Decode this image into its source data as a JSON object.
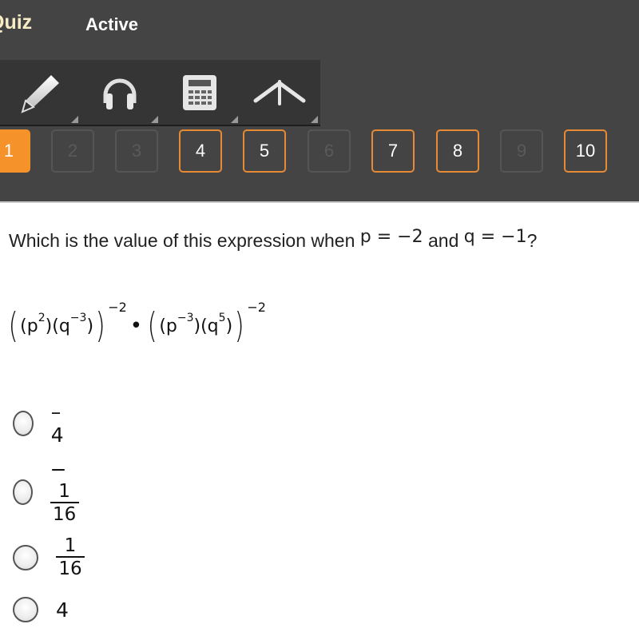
{
  "header": {
    "app_title": "Quiz",
    "status": "Active"
  },
  "toolbar": {
    "tools": [
      {
        "name": "pencil",
        "icon": "pencil-icon"
      },
      {
        "name": "audio",
        "icon": "headphones-icon"
      },
      {
        "name": "calculator",
        "icon": "calculator-icon"
      },
      {
        "name": "reference",
        "icon": "compass-icon"
      }
    ]
  },
  "question_nav": {
    "current": 1,
    "items": [
      {
        "label": "1",
        "state": "current"
      },
      {
        "label": "2",
        "state": "unanswered"
      },
      {
        "label": "3",
        "state": "unanswered"
      },
      {
        "label": "4",
        "state": "answered"
      },
      {
        "label": "5",
        "state": "answered"
      },
      {
        "label": "6",
        "state": "unanswered"
      },
      {
        "label": "7",
        "state": "answered"
      },
      {
        "label": "8",
        "state": "answered"
      },
      {
        "label": "9",
        "state": "unanswered"
      },
      {
        "label": "10",
        "state": "answered"
      }
    ]
  },
  "colors": {
    "accent": "#f5922a",
    "header_bg": "#444444",
    "toolbar_bg": "#353535"
  },
  "question": {
    "prompt_start": "Which is the value of this expression when ",
    "var1": "p = −2",
    "conjunction": " and ",
    "var2": "q = −1",
    "end": "?",
    "expression": {
      "open_outer": "(",
      "t1_base": "(p",
      "t1_exp": "2",
      "t1_mid": ")(q",
      "t1_exp2": "−3",
      "t1_close": ")",
      "close_outer": ")",
      "outer_exp1": "−2",
      "dot": "•",
      "t2_base": "(p",
      "t2_exp": "−3",
      "t2_mid": ")(q",
      "t2_exp2": "5",
      "t2_close": ")",
      "outer_exp2": "−2"
    }
  },
  "options": [
    {
      "label": "–4"
    },
    {
      "sign": "−",
      "numerator": "1",
      "denominator": "16"
    },
    {
      "numerator": "1",
      "denominator": "16"
    },
    {
      "label": "4"
    }
  ]
}
